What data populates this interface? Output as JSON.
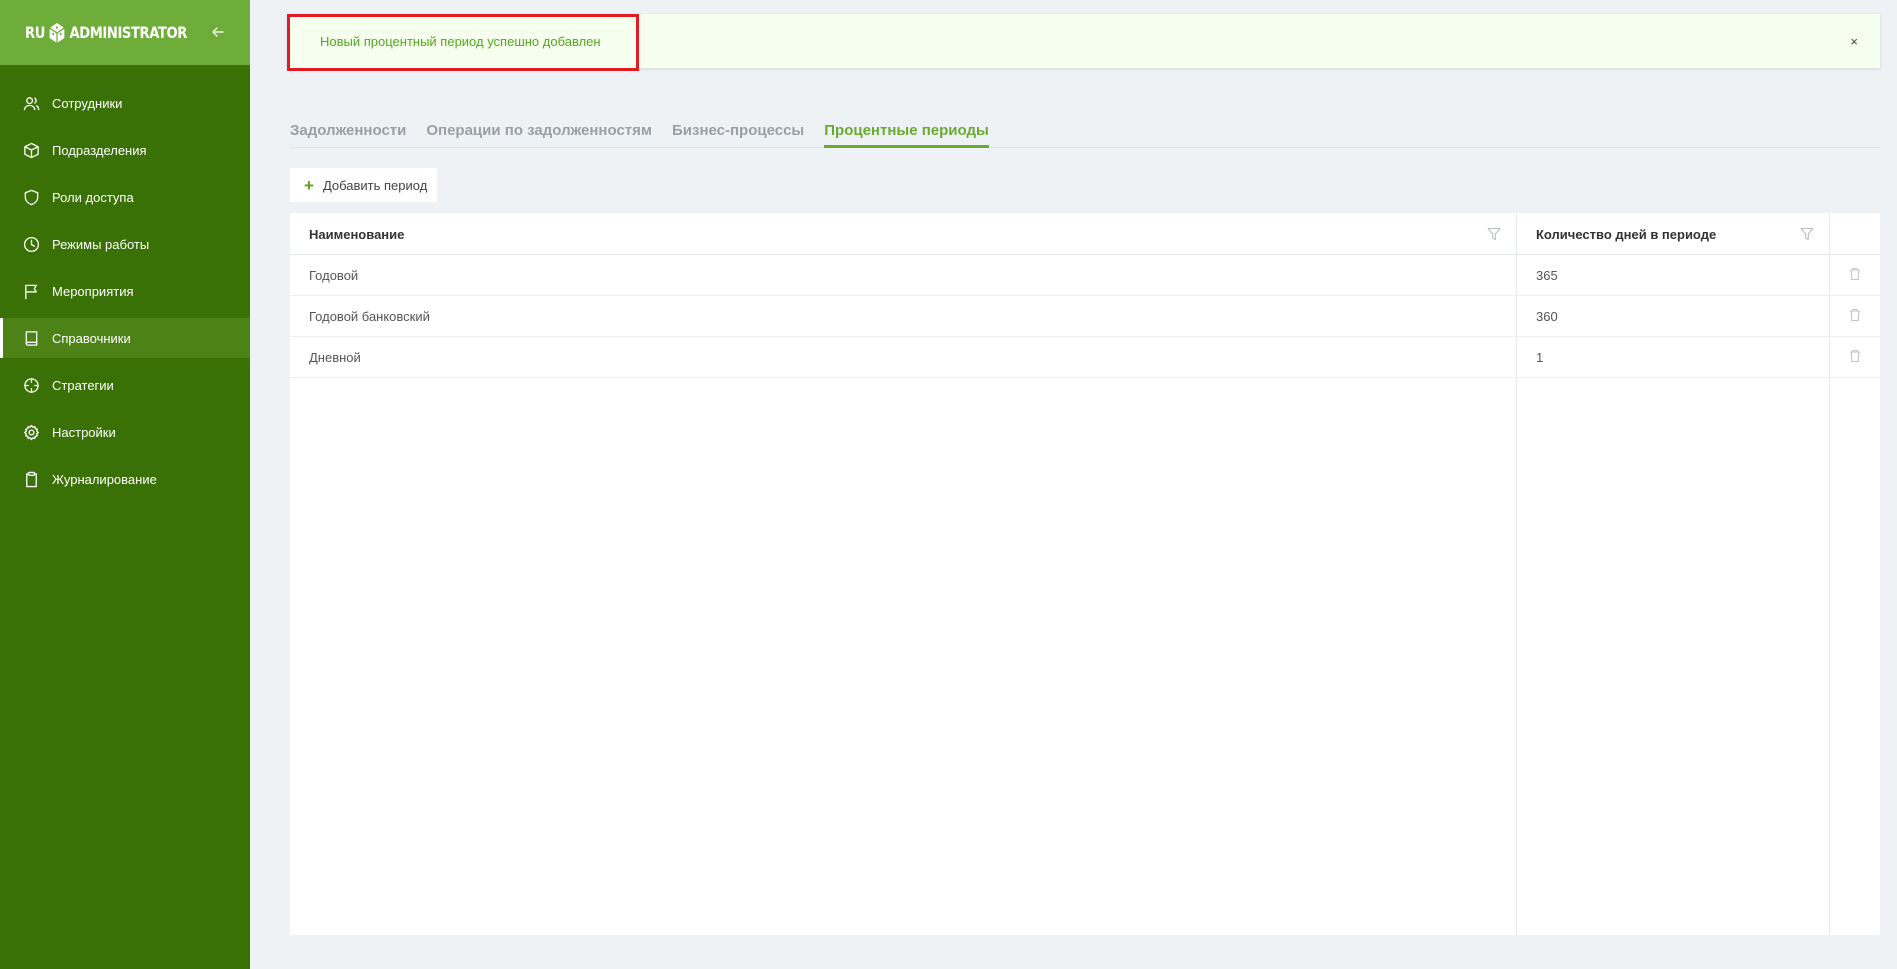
{
  "brand": {
    "left": "RU",
    "right": "ADMINISTRATOR",
    "logo_icon": "cube-logo-icon"
  },
  "sidebar": {
    "items": [
      {
        "label": "Сотрудники",
        "icon": "users-icon"
      },
      {
        "label": "Подразделения",
        "icon": "box-icon"
      },
      {
        "label": "Роли доступа",
        "icon": "shield-icon"
      },
      {
        "label": "Режимы работы",
        "icon": "clock-icon"
      },
      {
        "label": "Мероприятия",
        "icon": "flag-icon"
      },
      {
        "label": "Справочники",
        "icon": "book-icon",
        "active": true
      },
      {
        "label": "Стратегии",
        "icon": "crosshair-icon"
      },
      {
        "label": "Настройки",
        "icon": "gear-icon"
      },
      {
        "label": "Журналирование",
        "icon": "clipboard-icon"
      }
    ]
  },
  "notification": {
    "text": "Новый процентный период успешно добавлен",
    "close": "×"
  },
  "tabs": [
    {
      "label": "Задолженности"
    },
    {
      "label": "Операции по задолженностям"
    },
    {
      "label": "Бизнес-процессы"
    },
    {
      "label": "Процентные периоды",
      "active": true
    }
  ],
  "toolbar": {
    "add_label": "Добавить период",
    "add_icon": "+"
  },
  "table": {
    "headers": [
      "Наименование",
      "Количество дней в периоде"
    ],
    "rows": [
      [
        "Годовой",
        "365"
      ],
      [
        "Годовой банковский",
        "360"
      ],
      [
        "Дневной",
        "1"
      ]
    ]
  },
  "colors": {
    "sidebar": "#3a7106",
    "brand": "#6fad3a",
    "accent": "#6aaa32",
    "success_bg": "#f6ffed",
    "highlight": "#e01b24"
  }
}
